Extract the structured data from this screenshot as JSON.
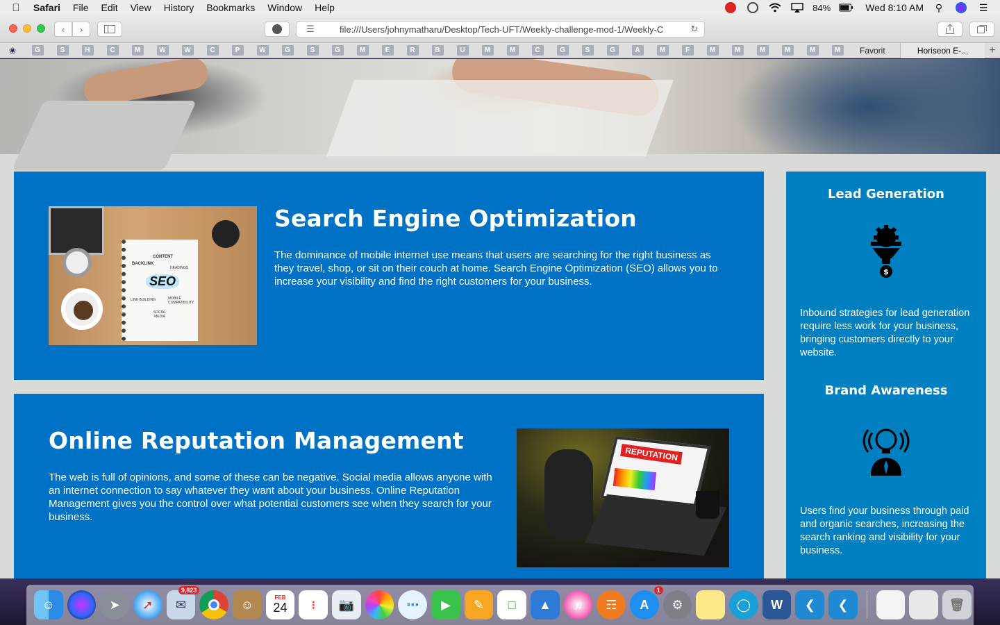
{
  "menubar": {
    "app": "Safari",
    "items": [
      "File",
      "Edit",
      "View",
      "History",
      "Bookmarks",
      "Window",
      "Help"
    ],
    "battery": "84%",
    "clock": "Wed 8:10 AM"
  },
  "toolbar": {
    "url": "file:///Users/johnymatharu/Desktop/Tech-UFT/Weekly-challenge-mod-1/Weekly-C"
  },
  "bookmarks": {
    "letters": [
      "G",
      "S",
      "H",
      "C",
      "M",
      "W",
      "W",
      "C",
      "P",
      "W",
      "G",
      "S",
      "G",
      "M",
      "E",
      "R",
      "B",
      "U",
      "M",
      "M",
      "C",
      "G",
      "S",
      "G",
      "A",
      "M",
      "F",
      "M",
      "M",
      "M",
      "M",
      "M",
      "M"
    ],
    "favorites_label": "Favorit",
    "tab_label": "Horiseon E-..."
  },
  "content": {
    "seo": {
      "title": "Search Engine Optimization",
      "text": "The dominance of mobile internet use means that users are searching for the right business as they travel, shop, or sit on their couch at home. Search Engine Optimization (SEO) allows you to increase your visibility and find the right customers for your business.",
      "image_words": [
        "CONTENT",
        "BACKLINK",
        "HEADINGS",
        "SEO",
        "LINK BUILDING",
        "MOBILE COMPATIBILITY",
        "SOCIAL MEDIA"
      ]
    },
    "orm": {
      "title": "Online Reputation Management",
      "text": "The web is full of opinions, and some of these can be negative. Social media allows anyone with an internet connection to say whatever they want about your business. Online Reputation Management gives you the control over what potential customers see when they search for your business.",
      "image_word": "REPUTATION"
    }
  },
  "aside": {
    "lead": {
      "title": "Lead Generation",
      "text": "Inbound strategies for lead generation require less work for your business, bringing customers directly to your website."
    },
    "brand": {
      "title": "Brand Awareness",
      "text": "Users find your business through paid and organic searches, increasing the search ranking and visibility for your business."
    }
  },
  "dock": {
    "mail_badge": "9,823",
    "calendar_month": "FEB",
    "calendar_day": "24",
    "appstore_badge": "1"
  },
  "colors": {
    "card_blue": "#0072c6",
    "aside_blue": "#0080c0",
    "page_bg": "#d9dcd6"
  }
}
